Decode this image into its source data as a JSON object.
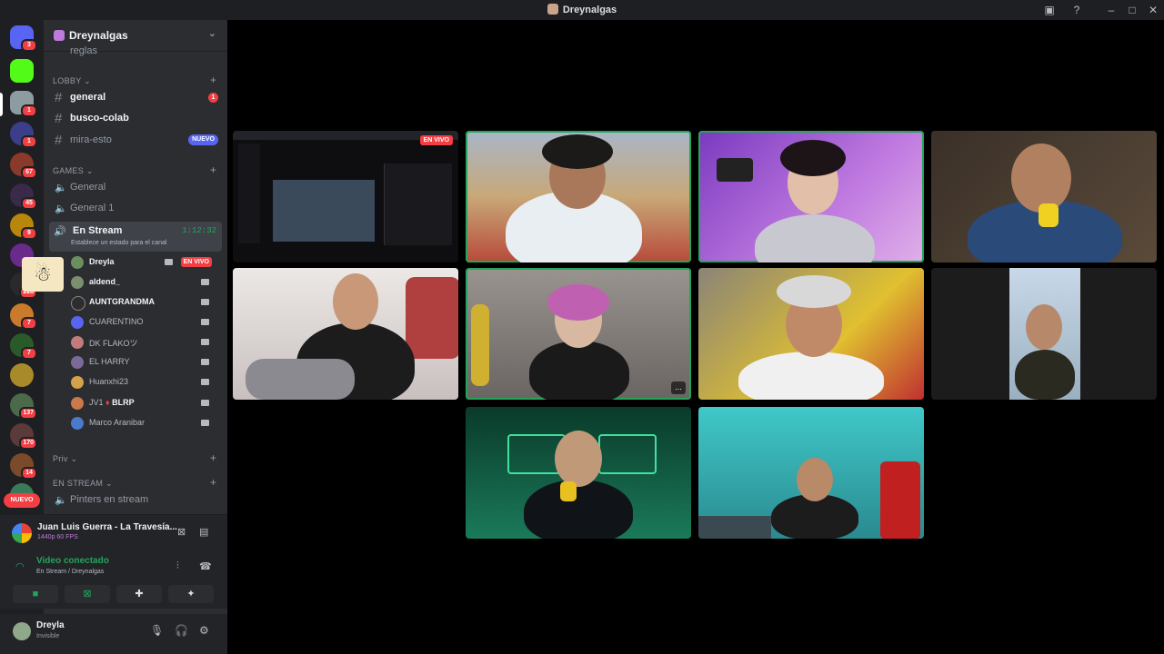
{
  "window": {
    "title": "Dreynalgas"
  },
  "guild_badges": [
    "3",
    "1",
    "1",
    "67",
    "45",
    "9",
    "7",
    "228",
    "7",
    "137",
    "170",
    "14"
  ],
  "guild_new_label": "NUEVO",
  "server": {
    "name": "Dreynalgas"
  },
  "channels": {
    "partial_top": "reglas",
    "lobby_category": "LOBBY",
    "general": {
      "label": "general",
      "unread": "1"
    },
    "busco_colab": "busco-colab",
    "mira_esto": {
      "label": "mira-esto",
      "badge": "NUEVO"
    },
    "games_category": "GAMES",
    "voice_general": "General",
    "voice_general1": "General 1",
    "active_voice": {
      "label": "En Stream",
      "timer": "1:12:32",
      "status": "Establece un estado para el canal"
    },
    "priv_category": "Priv",
    "en_stream_category": "EN STREAM",
    "pinters": "Pinters en stream"
  },
  "members": [
    {
      "name": "Dreyla",
      "live": "EN VIVO",
      "color": "#6b8f5e"
    },
    {
      "name": "aldend_",
      "color": "#7b8f6e"
    },
    {
      "name": "AUNTGRANDMA",
      "color": "#2d2d2d"
    },
    {
      "name": "CUARENTINO",
      "color": "#5865f2"
    },
    {
      "name": "DK FLAKOツ",
      "color": "#c27c7c"
    },
    {
      "name": "EL HARRY",
      "color": "#7a6a9a"
    },
    {
      "name": "Huanxhi23",
      "color": "#d4a24a"
    },
    {
      "name": "JV1",
      "tag": "BLRP",
      "color": "#c9794a"
    },
    {
      "name": "Marco Aranibar",
      "color": "#4a7ac9"
    }
  ],
  "music": {
    "title": "Juan Luis Guerra - La Travesía...",
    "quality": "1440p 60 FPS"
  },
  "voice_status": {
    "connected": "Video conectado",
    "location": "En Stream / Dreynalgas"
  },
  "user": {
    "name": "Dreyla",
    "status": "Invisible"
  },
  "stage": {
    "live_label": "EN VIVO",
    "more": "..."
  }
}
